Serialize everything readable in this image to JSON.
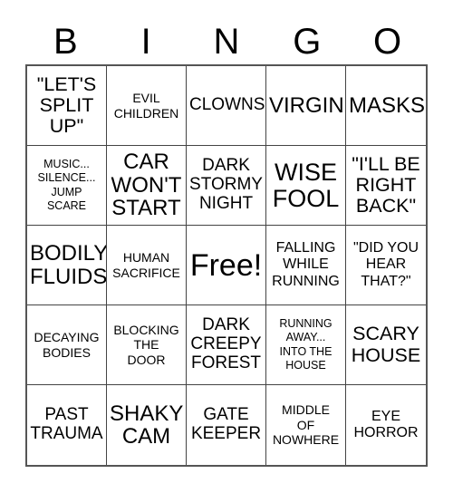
{
  "card": {
    "title": "BINGO",
    "background_color": "#ffffff",
    "text_color": "#000000",
    "border_color": "#555555",
    "grid_line_color": "#444444"
  },
  "header": {
    "letters": [
      {
        "label": "B"
      },
      {
        "label": "I"
      },
      {
        "label": "N"
      },
      {
        "label": "G"
      },
      {
        "label": "O"
      }
    ]
  },
  "grid": {
    "columns": 5,
    "rows": 5,
    "free_space_index": 12,
    "cells": [
      {
        "text": "\"LET'S\nSPLIT\nUP\"",
        "size": "xl",
        "free": false
      },
      {
        "text": "EVIL\nCHILDREN",
        "size": "sm",
        "free": false
      },
      {
        "text": "CLOWNS",
        "size": "lg",
        "free": false
      },
      {
        "text": "VIRGIN",
        "size": "2xl",
        "free": false
      },
      {
        "text": "MASKS",
        "size": "2xl",
        "free": false
      },
      {
        "text": "MUSIC...\nSILENCE...\nJUMP\nSCARE",
        "size": "xs",
        "free": false
      },
      {
        "text": "CAR\nWON'T\nSTART",
        "size": "2xl",
        "free": false
      },
      {
        "text": "DARK\nSTORMY\nNIGHT",
        "size": "lg",
        "free": false
      },
      {
        "text": "WISE\nFOOL",
        "size": "3xl",
        "free": false
      },
      {
        "text": "\"I'LL BE\nRIGHT\nBACK\"",
        "size": "xl",
        "free": false
      },
      {
        "text": "BODILY\nFLUIDS",
        "size": "2xl",
        "free": false
      },
      {
        "text": "HUMAN\nSACRIFICE",
        "size": "sm",
        "free": false
      },
      {
        "text": "Free!",
        "size": "free",
        "free": true
      },
      {
        "text": "FALLING\nWHILE\nRUNNING",
        "size": "md",
        "free": false
      },
      {
        "text": "\"DID YOU\nHEAR\nTHAT?\"",
        "size": "md",
        "free": false
      },
      {
        "text": "DECAYING\nBODIES",
        "size": "sm",
        "free": false
      },
      {
        "text": "BLOCKING\nTHE\nDOOR",
        "size": "sm",
        "free": false
      },
      {
        "text": "DARK\nCREEPY\nFOREST",
        "size": "lg",
        "free": false
      },
      {
        "text": "RUNNING\nAWAY...\nINTO THE\nHOUSE",
        "size": "xs",
        "free": false
      },
      {
        "text": "SCARY\nHOUSE",
        "size": "xl",
        "free": false
      },
      {
        "text": "PAST\nTRAUMA",
        "size": "lg",
        "free": false
      },
      {
        "text": "SHAKY\nCAM",
        "size": "2xl",
        "free": false
      },
      {
        "text": "GATE\nKEEPER",
        "size": "lg",
        "free": false
      },
      {
        "text": "MIDDLE\nOF\nNOWHERE",
        "size": "sm",
        "free": false
      },
      {
        "text": "EYE\nHORROR",
        "size": "md",
        "free": false
      }
    ]
  }
}
